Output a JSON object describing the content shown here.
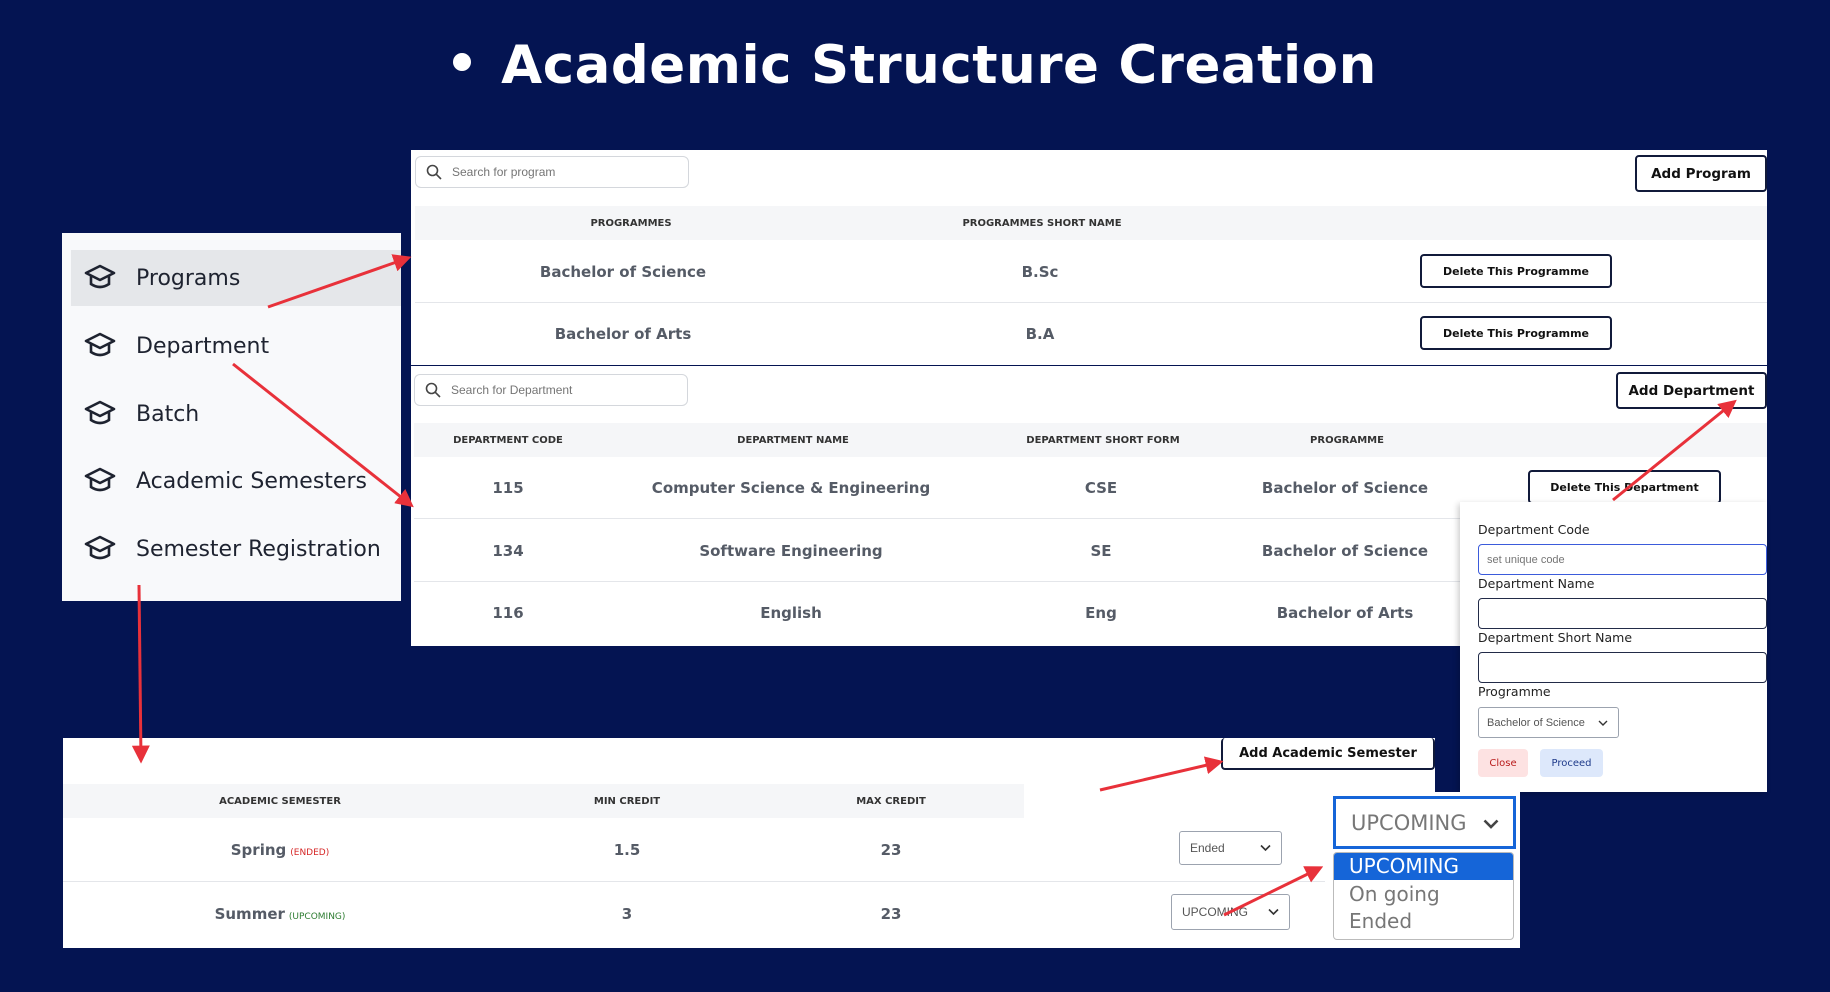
{
  "page_title": "Academic Structure Creation",
  "sidebar": {
    "items": [
      {
        "label": "Programs",
        "icon": "graduation-cap-icon",
        "active": true
      },
      {
        "label": "Department",
        "icon": "graduation-cap-icon"
      },
      {
        "label": "Batch",
        "icon": "graduation-cap-icon"
      },
      {
        "label": "Academic Semesters",
        "icon": "graduation-cap-icon"
      },
      {
        "label": "Semester Registration",
        "icon": "graduation-cap-icon"
      }
    ]
  },
  "programs": {
    "search_placeholder": "Search for program",
    "add_label": "Add Program",
    "headers": [
      "PROGRAMMES",
      "PROGRAMMES SHORT NAME"
    ],
    "rows": [
      {
        "name": "Bachelor of Science",
        "short": "B.Sc",
        "action": "Delete This Programme"
      },
      {
        "name": "Bachelor of Arts",
        "short": "B.A",
        "action": "Delete This Programme"
      }
    ]
  },
  "departments": {
    "search_placeholder": "Search for Department",
    "add_label": "Add Department",
    "headers": [
      "DEPARTMENT CODE",
      "DEPARTMENT NAME",
      "DEPARTMENT SHORT FORM",
      "PROGRAMME"
    ],
    "rows": [
      {
        "code": "115",
        "name": "Computer Science & Engineering",
        "short": "CSE",
        "programme": "Bachelor of Science"
      },
      {
        "code": "134",
        "name": "Software Engineering",
        "short": "SE",
        "programme": "Bachelor of Science"
      },
      {
        "code": "116",
        "name": "English",
        "short": "Eng",
        "programme": "Bachelor of Arts"
      }
    ],
    "delete_label": "Delete This Department"
  },
  "department_form": {
    "code_label": "Department Code",
    "code_placeholder": "set unique code",
    "name_label": "Department Name",
    "short_label": "Department Short Name",
    "programme_label": "Programme",
    "programme_value": "Bachelor of Science",
    "close_label": "Close",
    "proceed_label": "Proceed"
  },
  "semesters": {
    "add_label": "Add Academic Semester",
    "headers": [
      "ACADEMIC SEMESTER",
      "MIN CREDIT",
      "MAX CREDIT"
    ],
    "rows": [
      {
        "name": "Spring",
        "status": "(ENDED)",
        "min": "1.5",
        "max": "23",
        "select": "Ended"
      },
      {
        "name": "Summer",
        "status": "(UPCOMING)",
        "min": "3",
        "max": "23",
        "select": "UPCOMING"
      }
    ]
  },
  "status_dropdown": {
    "selected": "UPCOMING",
    "options": [
      "UPCOMING",
      "On going",
      "Ended"
    ]
  },
  "colors": {
    "background": "#041452",
    "arrow": "#e8313a",
    "ended": "#d62828",
    "upcoming": "#2e7d32",
    "highlight": "#1565d8"
  }
}
